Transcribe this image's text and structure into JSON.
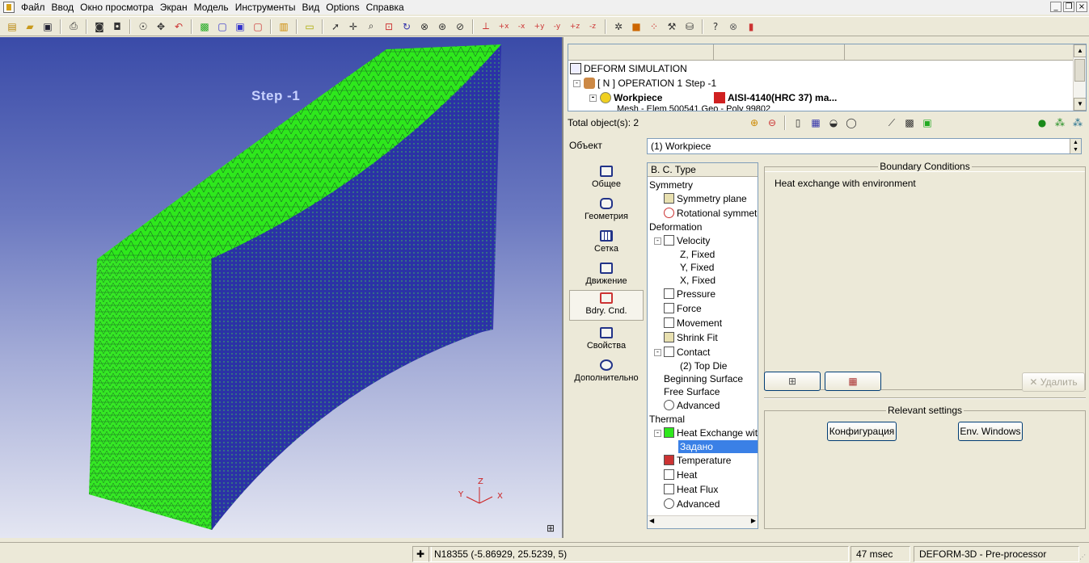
{
  "menu": [
    "Файл",
    "Ввод",
    "Окно просмотра",
    "Экран",
    "Модель",
    "Инструменты",
    "Вид",
    "Options",
    "Справка"
  ],
  "viewport": {
    "step_label": "Step   -1",
    "axis": {
      "z": "Z",
      "y": "Y",
      "x": "X"
    }
  },
  "tree": {
    "root": "DEFORM SIMULATION",
    "operation": "[ N ] OPERATION 1  Step -1",
    "workpiece": "Workpiece",
    "material": "AISI-4140(HRC 37) ma...",
    "mesh_row": "Mesh - Elem 500541  Geo - Poly 99802"
  },
  "object_count": "Total object(s): 2",
  "object": {
    "label": "Объект",
    "value": "(1) Workpiece"
  },
  "nav": [
    {
      "label": "Общее"
    },
    {
      "label": "Геометрия"
    },
    {
      "label": "Сетка"
    },
    {
      "label": "Движение"
    },
    {
      "label": "Bdry. Cnd."
    },
    {
      "label": "Свойства"
    },
    {
      "label": "Дополнительно"
    }
  ],
  "bc_tree": {
    "header": "B. C. Type",
    "items": [
      "Symmetry",
      "Symmetry plane",
      "Rotational symmetry",
      "Deformation",
      "Velocity",
      "Z, Fixed",
      "Y, Fixed",
      "X, Fixed",
      "Pressure",
      "Force",
      "Movement",
      "Shrink Fit",
      "Contact",
      "(2) Top Die",
      "Beginning Surface",
      "Free Surface",
      "Advanced",
      "Thermal",
      "Heat Exchange with",
      "Задано",
      "Temperature",
      "Heat",
      "Heat Flux",
      "Advanced"
    ]
  },
  "boundary_conditions": {
    "title": "Boundary Conditions",
    "content": "Heat exchange with environment"
  },
  "buttons": {
    "delete": "Удалить"
  },
  "relevant": {
    "title": "Relevant settings",
    "config": "Конфигурация",
    "env": "Env. Windows"
  },
  "status": {
    "coords": "N18355 (-5.86929, 25.5239, 5)",
    "time": "47 msec",
    "mode": "DEFORM-3D  - Pre-processor"
  },
  "colors": {
    "mesh_green": "#2ee81c",
    "mesh_blue": "#2b32a6",
    "selection": "#3a80e6"
  }
}
